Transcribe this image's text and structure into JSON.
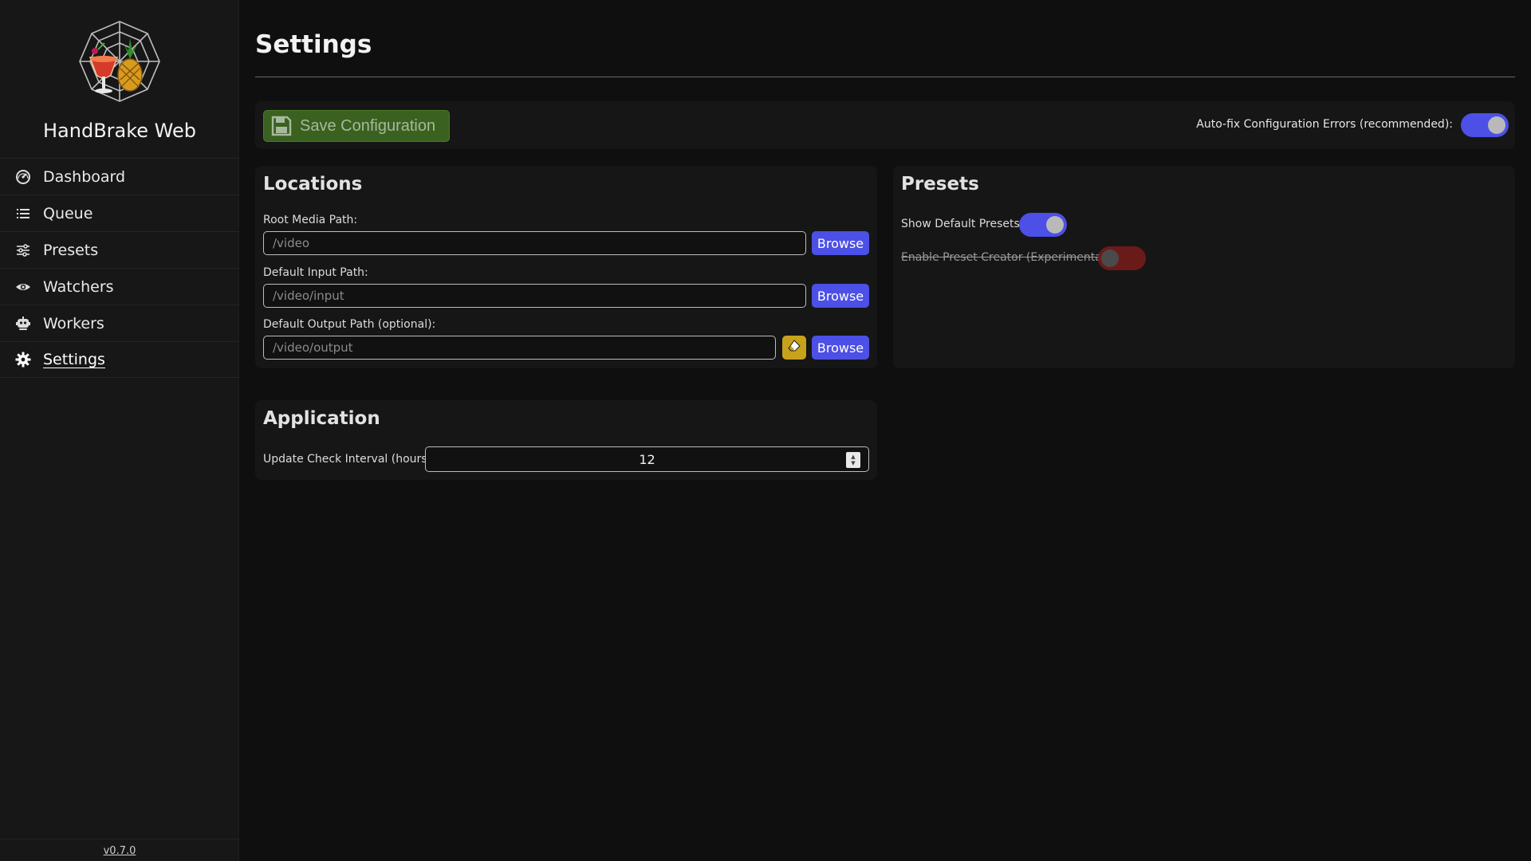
{
  "app": {
    "title": "HandBrake Web",
    "version": "v0.7.0",
    "logo_icon": "handbrake-logo-icon"
  },
  "sidebar": {
    "items": [
      {
        "label": "Dashboard",
        "icon": "gauge-icon",
        "active": false
      },
      {
        "label": "Queue",
        "icon": "list-icon",
        "active": false
      },
      {
        "label": "Presets",
        "icon": "sliders-icon",
        "active": false
      },
      {
        "label": "Watchers",
        "icon": "eye-icon",
        "active": false
      },
      {
        "label": "Workers",
        "icon": "robot-icon",
        "active": false
      },
      {
        "label": "Settings",
        "icon": "gear-icon",
        "active": true
      }
    ]
  },
  "page": {
    "title": "Settings"
  },
  "toolbar": {
    "save_label": "Save Configuration",
    "save_icon": "floppy-disk-icon",
    "autofix_label": "Auto-fix Configuration Errors (recommended):",
    "autofix_enabled": true
  },
  "locations": {
    "title": "Locations",
    "root_media": {
      "label": "Root Media Path:",
      "placeholder": "/video"
    },
    "default_input": {
      "label": "Default Input Path:",
      "placeholder": "/video/input"
    },
    "default_output": {
      "label": "Default Output Path (optional):",
      "placeholder": "/video/output"
    },
    "browse_label": "Browse",
    "clear_icon": "eraser-icon"
  },
  "presets": {
    "title": "Presets",
    "show_default_label": "Show Default Presets:",
    "show_default_enabled": true,
    "preset_creator_label": "Enable Preset Creator (Experimental):",
    "preset_creator_enabled": false
  },
  "application": {
    "title": "Application",
    "update_interval_label": "Update Check Interval (hours):",
    "update_interval_value": "12"
  },
  "colors": {
    "background": "#0f0f0f",
    "panel": "#161616",
    "accent_blue": "#4c50e6",
    "save_green": "#3a611f",
    "clear_yellow": "#c9a21c",
    "toggle_off_red": "#6b1a1a"
  }
}
